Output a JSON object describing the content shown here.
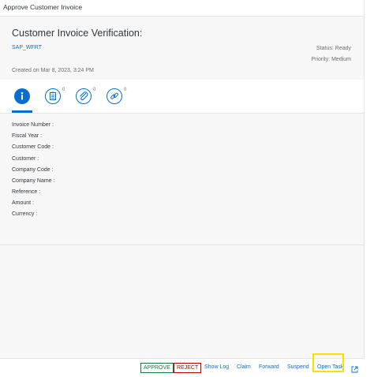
{
  "window": {
    "title": "Approve Customer Invoice"
  },
  "header": {
    "title": "Customer Invoice Verification:",
    "sub_link": "SAP_WFRT",
    "status": "Status: Ready",
    "priority": "Priority: Medium",
    "created": "Created on Mar 8, 2023, 3:24 PM"
  },
  "tabs": [
    {
      "name": "information",
      "icon": "info-icon",
      "count": ""
    },
    {
      "name": "notes",
      "icon": "notes-icon",
      "count": "0"
    },
    {
      "name": "attachments",
      "icon": "paperclip-icon",
      "count": "0"
    },
    {
      "name": "related-objects",
      "icon": "link-icon",
      "count": "0"
    }
  ],
  "fields": [
    {
      "label": "Invoice Number :"
    },
    {
      "label": "Fiscal Year :"
    },
    {
      "label": "Customer Code :"
    },
    {
      "label": "Customer :"
    },
    {
      "label": "Company Code :"
    },
    {
      "label": "Company Name :"
    },
    {
      "label": "Reference :"
    },
    {
      "label": "Amount :"
    },
    {
      "label": "Currency :"
    }
  ],
  "footer": {
    "approve": "APPROVE",
    "reject": "REJECT",
    "show_log": "Show Log",
    "claim": "Claim",
    "forward": "Forward",
    "suspend": "Suspend",
    "open_task": "Open Task"
  },
  "colors": {
    "accent": "#0a6ed1",
    "approve": "#107e3e",
    "reject": "#bb0000",
    "highlight": "#f6e200"
  }
}
